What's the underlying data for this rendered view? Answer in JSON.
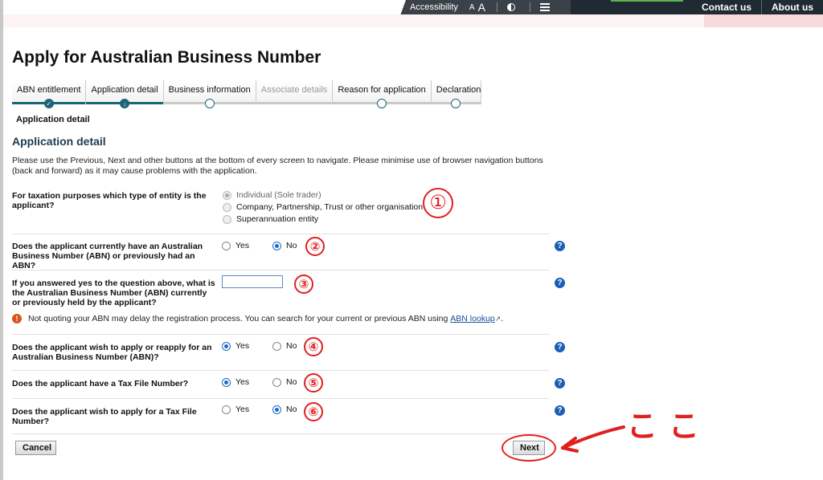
{
  "topbar": {
    "accessibility": "Accessibility",
    "font_small": "A",
    "font_large": "A",
    "links": [
      "Contact us",
      "About us"
    ]
  },
  "page": {
    "title": "Apply for Australian Business Number",
    "sub_label": "Application detail",
    "section_title": "Application detail",
    "intro": "Please use the Previous, Next and other buttons at the bottom of every screen to navigate. Please minimise use of browser navigation buttons (back and forward) as it may cause problems with the application."
  },
  "stepper": [
    {
      "label": "ABN entitlement",
      "state": "done"
    },
    {
      "label": "Application detail",
      "state": "current"
    },
    {
      "label": "Business information",
      "state": "pending"
    },
    {
      "label": "Associate details",
      "state": "disabled"
    },
    {
      "label": "Reason for application",
      "state": "pending"
    },
    {
      "label": "Declaration",
      "state": "pending"
    }
  ],
  "questions": {
    "entity": {
      "label": "For taxation purposes which type of entity is the applicant?",
      "options": [
        "Individual (Sole trader)",
        "Company, Partnership, Trust or other organisation",
        "Superannuation entity"
      ],
      "selected": "Individual (Sole trader)"
    },
    "has_abn": {
      "label": "Does the applicant currently have an Australian Business Number (ABN) or previously had an ABN?",
      "yes": "Yes",
      "no": "No",
      "selected": "No"
    },
    "abn_number": {
      "label": "If you answered yes to the question above, what is the Australian Business Number (ABN) currently or previously held by the applicant?",
      "value": ""
    },
    "warning": {
      "text": "Not quoting your ABN may delay the registration process. You can search for your current or previous ABN using ",
      "link": "ABN lookup",
      "suffix": "."
    },
    "apply_abn": {
      "label": "Does the applicant wish to apply or reapply for an Australian Business Number (ABN)?",
      "yes": "Yes",
      "no": "No",
      "selected": "Yes"
    },
    "has_tfn": {
      "label": "Does the applicant have a Tax File Number?",
      "yes": "Yes",
      "no": "No",
      "selected": "Yes"
    },
    "apply_tfn": {
      "label": "Does the applicant wish to apply for a Tax File Number?",
      "yes": "Yes",
      "no": "No",
      "selected": "No"
    }
  },
  "help_icon": "?",
  "annotations": {
    "markers": [
      "①",
      "②",
      "③",
      "④",
      "⑤",
      "⑥"
    ],
    "koko": "ここ",
    "color": "#e02020"
  },
  "buttons": {
    "cancel": "Cancel",
    "next": "Next"
  }
}
